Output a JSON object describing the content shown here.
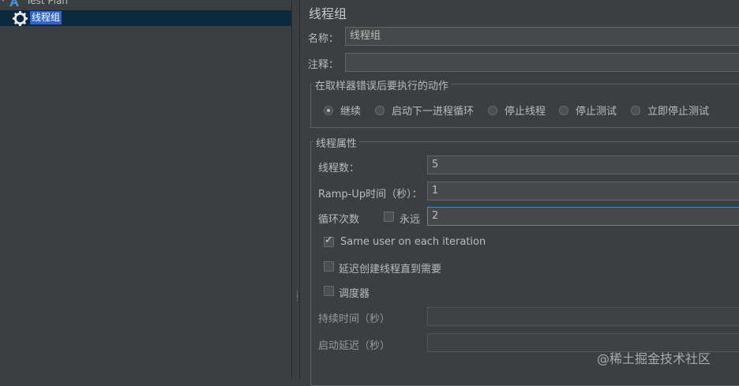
{
  "tree": {
    "test_plan_label": "Test Plan",
    "thread_group_label": "线程组"
  },
  "panel": {
    "title": "线程组",
    "name_label": "名称：",
    "name_value": "线程组",
    "comment_label": "注释：",
    "comment_value": "",
    "error_action": {
      "legend": "在取样器错误后要执行的动作",
      "options": [
        "继续",
        "启动下一进程循环",
        "停止线程",
        "停止测试",
        "立即停止测试"
      ],
      "selected": "继续"
    },
    "thread_props": {
      "legend": "线程属性",
      "threads_label": "线程数：",
      "threads_value": "5",
      "rampup_label": "Ramp-Up时间（秒）：",
      "rampup_value": "1",
      "loop_label": "循环次数",
      "forever_label": "永远",
      "forever_checked": false,
      "loop_value": "2",
      "same_user_label": "Same user on each iteration",
      "same_user_checked": true,
      "delay_label": "延迟创建线程直到需要",
      "delay_checked": false,
      "scheduler_label": "调度器",
      "scheduler_checked": false,
      "duration_label": "持续时间（秒）",
      "duration_value": "",
      "startup_delay_label": "启动延迟（秒）",
      "startup_delay_value": ""
    }
  },
  "watermark": "@稀土掘金技术社区"
}
